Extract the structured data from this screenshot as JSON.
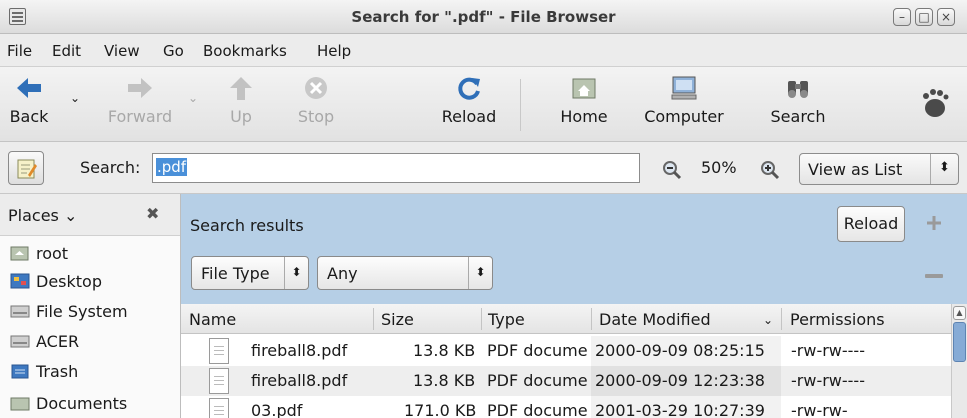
{
  "window": {
    "title": "Search for \".pdf\" - File Browser",
    "minimize": "–",
    "maximize": "□",
    "close": "×"
  },
  "menu": {
    "file": "File",
    "edit": "Edit",
    "view": "View",
    "go": "Go",
    "bookmarks": "Bookmarks",
    "help": "Help"
  },
  "toolbar": {
    "back": "Back",
    "forward": "Forward",
    "up": "Up",
    "stop": "Stop",
    "reload": "Reload",
    "home": "Home",
    "computer": "Computer",
    "search": "Search"
  },
  "location": {
    "search_label": "Search:",
    "search_value": ".pdf",
    "zoom_level": "50%",
    "view_mode": "View as List",
    "view_arrows": "⬍"
  },
  "sidebar": {
    "header": "Places",
    "items": [
      {
        "label": "root",
        "icon": "home-folder-icon"
      },
      {
        "label": "Desktop",
        "icon": "desktop-icon"
      },
      {
        "label": "File System",
        "icon": "drive-icon"
      },
      {
        "label": "ACER",
        "icon": "drive-icon"
      },
      {
        "label": "Trash",
        "icon": "trash-icon"
      },
      {
        "label": "Documents",
        "icon": "folder-icon"
      }
    ]
  },
  "search_panel": {
    "title": "Search results",
    "reload_button": "Reload",
    "filter_type": "File Type",
    "filter_value": "Any",
    "arrows": "⬍"
  },
  "columns": {
    "name": "Name",
    "size": "Size",
    "type": "Type",
    "date": "Date Modified",
    "perms": "Permissions"
  },
  "files": [
    {
      "name": "fireball8.pdf",
      "size": "13.8 KB",
      "type": "PDF docume",
      "date": "2000-09-09 08:25:15",
      "perms": "-rw-rw----"
    },
    {
      "name": "fireball8.pdf",
      "size": "13.8 KB",
      "type": "PDF docume",
      "date": "2000-09-09 12:23:38",
      "perms": "-rw-rw----"
    },
    {
      "name": "03.pdf",
      "size": "171.0 KB",
      "type": "PDF docume",
      "date": "2001-03-29 10:27:39",
      "perms": "-rw-rw-"
    }
  ],
  "colors": {
    "panel_blue": "#b6cfe6",
    "selection": "#4a90d9",
    "toolbar_blue": "#2f6fb8"
  }
}
